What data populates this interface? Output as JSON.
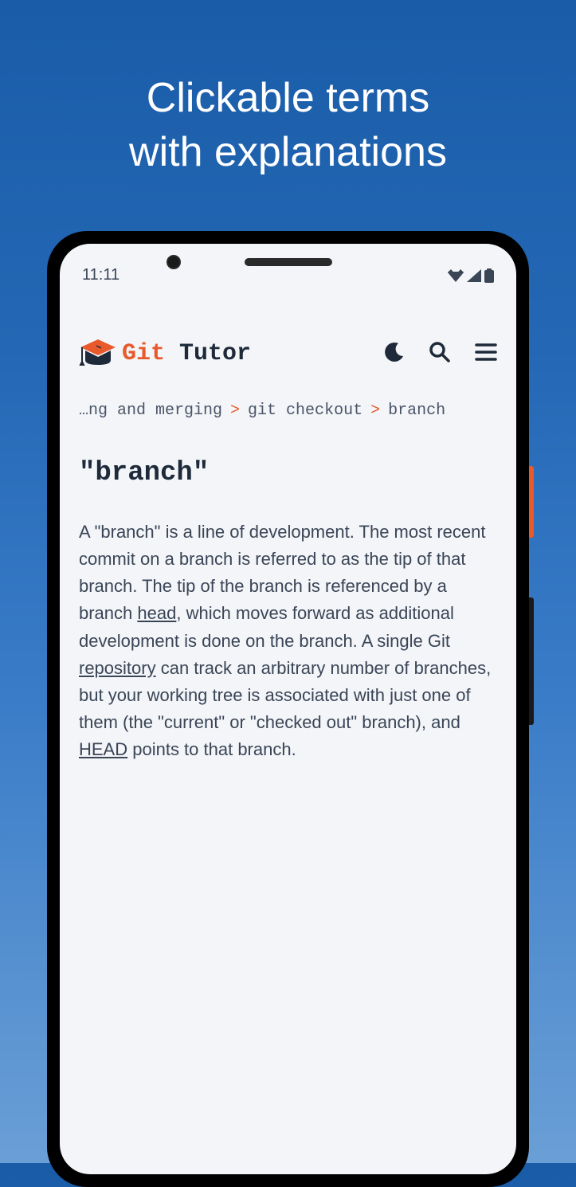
{
  "promo": {
    "line1": "Clickable terms",
    "line2": "with explanations"
  },
  "status_bar": {
    "time": "11:11"
  },
  "header": {
    "logo_git": "Git",
    "logo_tutor": "Tutor"
  },
  "breadcrumb": {
    "item1": "…ng and merging",
    "sep": ">",
    "item2": "git checkout",
    "item3": "branch"
  },
  "page": {
    "title": "\"branch\"",
    "body_part1": "A \"branch\" is a line of development. The most recent commit on a branch is referred to as the tip of that branch. The tip of the branch is referenced by a branch ",
    "link1": "head",
    "body_part2": ", which moves forward as additional development is done on the branch. A single Git ",
    "link2": "repository",
    "body_part3": " can track an arbitrary number of branches, but your working tree is associated with just one of them (the \"current\" or \"checked out\" branch), and ",
    "link3": "HEAD",
    "body_part4": " points to that branch."
  }
}
